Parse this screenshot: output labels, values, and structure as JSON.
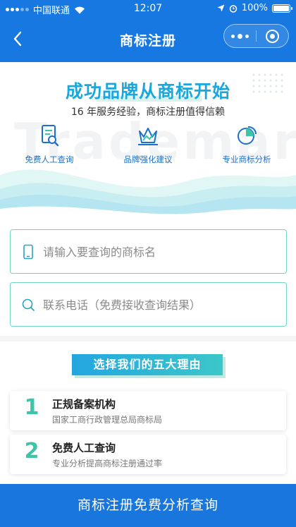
{
  "status_bar": {
    "carrier": "中国联通",
    "time": "12:07",
    "battery": "100%"
  },
  "nav": {
    "title": "商标注册"
  },
  "hero": {
    "watermark": "Trademark",
    "slogan": "成功品牌从商标开始",
    "subtitle": "16 年服务经验，商标注册值得信赖",
    "features": [
      {
        "label": "免费人工查询",
        "icon": "document-search-icon"
      },
      {
        "label": "品牌强化建议",
        "icon": "crown-chart-icon"
      },
      {
        "label": "专业商标分析",
        "icon": "pie-chart-icon"
      }
    ]
  },
  "form": {
    "trademark_placeholder": "请输入要查询的商标名",
    "phone_placeholder": "联系电话（免费接收查询结果）"
  },
  "reasons": {
    "heading": "选择我们的五大理由",
    "items": [
      {
        "num": "1",
        "title": "正规备案机构",
        "desc": "国家工商行政管理总局商标局"
      },
      {
        "num": "2",
        "title": "免费人工查询",
        "desc": "专业分析提高商标注册通过率"
      }
    ]
  },
  "cta": {
    "label": "商标注册免费分析查询"
  },
  "colors": {
    "brand_blue": "#1678e0",
    "teal": "#3dc5a8",
    "slogan": "#19a7de"
  }
}
